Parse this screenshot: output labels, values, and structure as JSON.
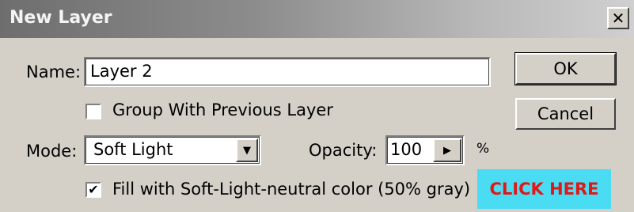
{
  "dialog": {
    "title": "New Layer",
    "close_glyph": "✕"
  },
  "name_row": {
    "label": "Name:",
    "value": "Layer 2"
  },
  "group_checkbox": {
    "label": "Group With Previous Layer",
    "checked": false
  },
  "mode_row": {
    "label": "Mode:",
    "value": "Soft Light",
    "arrow_glyph": "▼"
  },
  "opacity_row": {
    "label": "Opacity:",
    "value": "100",
    "arrow_glyph": "▶",
    "unit": "%"
  },
  "fill_checkbox": {
    "label": "Fill with Soft-Light-neutral color (50% gray)",
    "checked": true,
    "check_glyph": "✔"
  },
  "buttons": {
    "ok": "OK",
    "cancel": "Cancel"
  },
  "callout": {
    "text": "CLICK HERE",
    "bg_color": "#49dcf2",
    "text_color": "#e01818"
  }
}
